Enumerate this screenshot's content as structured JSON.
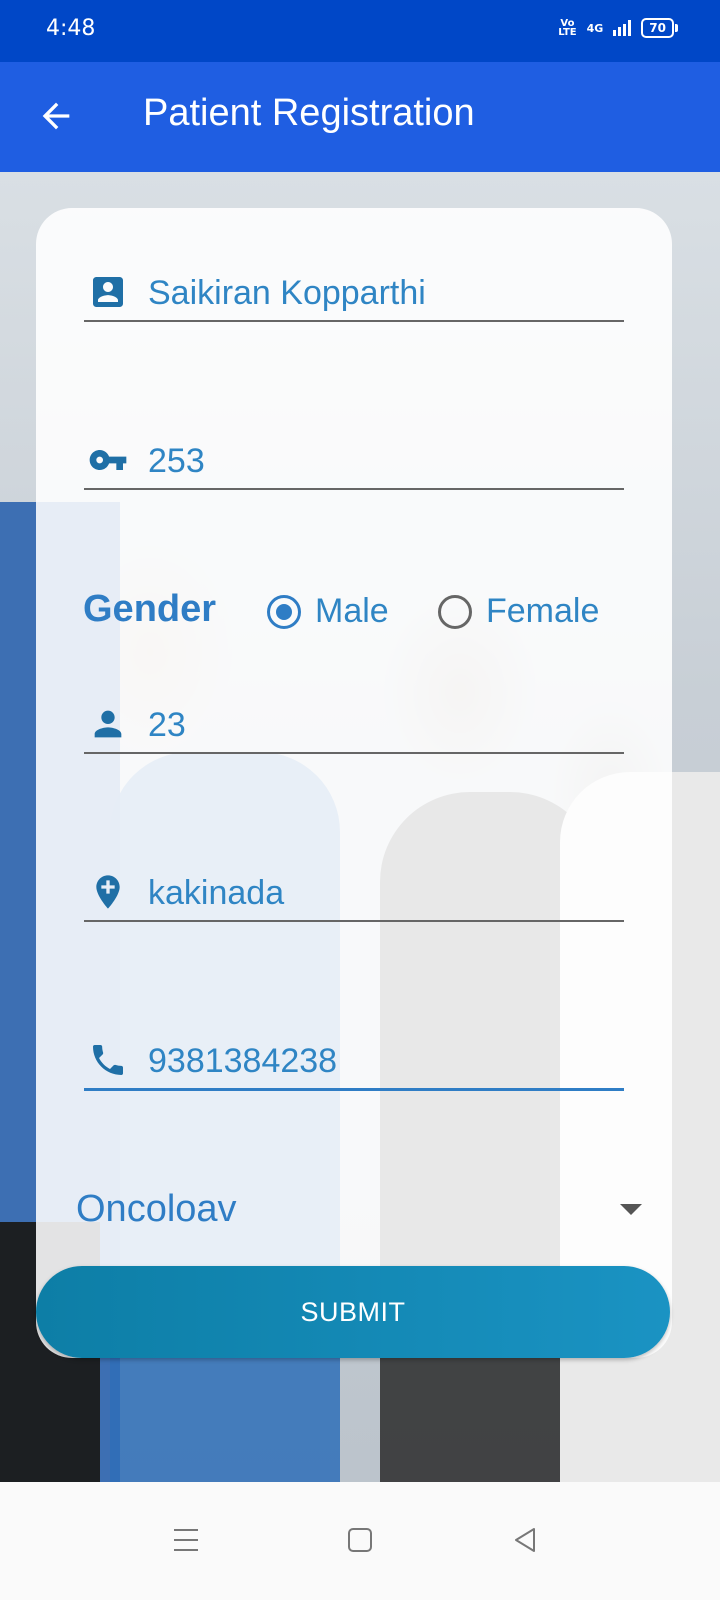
{
  "status_bar": {
    "time": "4:48",
    "volte": "Vo LTE",
    "network": "4G",
    "battery": "70"
  },
  "app_bar": {
    "title": "Patient Registration",
    "back_icon": "arrow-left-icon"
  },
  "form": {
    "name": {
      "icon": "contact-card-icon",
      "value": "Saikiran Kopparthi"
    },
    "patient_id": {
      "icon": "key-icon",
      "value": "253"
    },
    "gender": {
      "label": "Gender",
      "options": [
        {
          "label": "Male",
          "selected": true
        },
        {
          "label": "Female",
          "selected": false
        }
      ]
    },
    "age": {
      "icon": "person-icon",
      "value": "23"
    },
    "location": {
      "icon": "add-location-icon",
      "value": "kakinada"
    },
    "phone": {
      "icon": "phone-icon",
      "value": "9381384238"
    },
    "department": {
      "value": "Oncoloav",
      "icon": "dropdown-caret-icon"
    },
    "submit_label": "SUBMIT"
  },
  "colors": {
    "status_bar": "#0047c7",
    "app_bar": "#1f5ee2",
    "accent": "#2f7dc5",
    "submit": "#1a93c3"
  }
}
